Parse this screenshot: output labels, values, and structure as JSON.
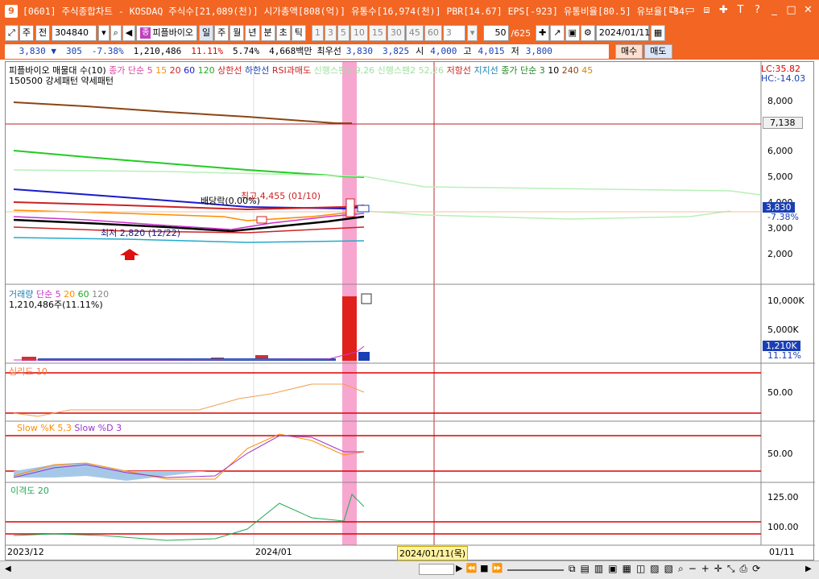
{
  "window": {
    "app_icon": "9",
    "title": "[0601] 주식종합차트 - KOSDAQ 주식수[21,089(천)] 시가총액[808(억)] 유통수[16,974(천)] PBR[14.67] EPS[-923] 유통비율[80.5] 유보율[-34.2] S"
  },
  "toolbar": {
    "period": "주",
    "prev_label": "전",
    "code": "304840",
    "stock_badge": "종",
    "stock_name": "피플바이오",
    "timeframes": [
      "일",
      "주",
      "월",
      "년",
      "분",
      "초",
      "틱"
    ],
    "intervals": [
      "1",
      "3",
      "5",
      "10",
      "15",
      "30",
      "45",
      "60"
    ],
    "interval_value": "3",
    "count": "50",
    "count_total": "/625",
    "date": "2024/01/11"
  },
  "quote": {
    "price": "3,830",
    "change": "305",
    "change_pct": "-7.38%",
    "volume": "1,210,486",
    "vol_pct": "11.11%",
    "turnover": "5.74%",
    "amount": "4,668백만",
    "best_label": "최우선",
    "best_value": "3,830",
    "ask_value": "3,825",
    "open_label": "시",
    "open": "4,000",
    "high_label": "고",
    "high": "4,015",
    "low_label": "저",
    "low": "3,800",
    "buy_label": "매수",
    "sell_label": "매도"
  },
  "price_pane": {
    "legend_line1": [
      "피플바이오 매물대 수(10)",
      "종가 단순 5",
      "15",
      "20",
      "60",
      "120",
      "상한선",
      "하한선",
      "RSI과매도",
      "신행스팬1 9,26",
      "신행스팬2 52,26",
      "저항선",
      "지지선",
      "종가 단순 3",
      "10",
      "240",
      "45"
    ],
    "legend_line2": "150500 강세패턴 약세패턴",
    "lc": "LC:35.82",
    "hc": "HC:-14.03",
    "axis": [
      "8,000",
      "6,000",
      "5,000",
      "4,000",
      "3,000",
      "2,000"
    ],
    "line_value": "7,138",
    "current": "3,830",
    "current_pct": "-7.38%",
    "annot_high": "최고 4,455 (01/10)",
    "annot_low": "최저 2,820 (12/22)",
    "annot_div": "배당락(0.00%)"
  },
  "volume_pane": {
    "legend": [
      "거래량",
      "단순 5",
      "20",
      "60",
      "120"
    ],
    "value": "1,210,486주(11.11%)",
    "axis": [
      "10,000K",
      "5,000K"
    ],
    "current": "1,210K",
    "current_pct": "11.11%"
  },
  "psych_pane": {
    "legend": "심리도 10",
    "axis": "50.00"
  },
  "slow_pane": {
    "legend": [
      "Slow %K 5,3",
      "Slow %D 3"
    ],
    "axis": "50.00"
  },
  "disparity_pane": {
    "legend": "이격도 20",
    "axis": [
      "125.00",
      "100.00"
    ]
  },
  "xaxis": {
    "labels": [
      "2023/12",
      "2024/01"
    ],
    "cursor_date": "2024/01/11(목)",
    "right_label": "01/11"
  },
  "colors": {
    "accent": "#f26522",
    "highlight": "#f7a6cf",
    "cursor": "#c0272d",
    "up": "#e0201b",
    "down": "#1a3fb5"
  }
}
